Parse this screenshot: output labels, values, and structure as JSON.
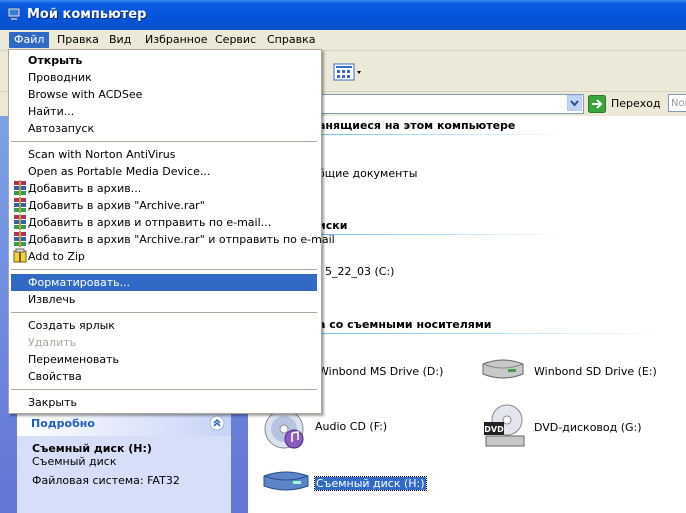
{
  "window": {
    "title": "Мой компьютер"
  },
  "menubar": {
    "items": [
      {
        "label": "Файл",
        "active": true
      },
      {
        "label": "Правка"
      },
      {
        "label": "Вид"
      },
      {
        "label": "Избранное"
      },
      {
        "label": "Сервис"
      },
      {
        "label": "Справка"
      }
    ]
  },
  "address": {
    "go_label": "Переход",
    "next_trunc": "Nor"
  },
  "file_menu": {
    "items": [
      {
        "label": "Открыть",
        "bold": true
      },
      {
        "label": "Проводник"
      },
      {
        "label": "Browse with ACDSee"
      },
      {
        "label": "Найти..."
      },
      {
        "label": "Автозапуск"
      },
      {
        "label": "Scan with Norton AntiVirus"
      },
      {
        "label": "Open as Portable Media Device..."
      },
      {
        "label": "Добавить в архив...",
        "icon": "winrar-icon"
      },
      {
        "label": "Добавить в архив \"Archive.rar\"",
        "icon": "winrar-icon"
      },
      {
        "label": "Добавить в архив и отправить по e-mail...",
        "icon": "winrar-icon"
      },
      {
        "label": "Добавить в архив \"Archive.rar\" и отправить по e-mail",
        "icon": "winrar-icon"
      },
      {
        "label": "Add to Zip",
        "icon": "winzip-icon"
      },
      {
        "label": "Форматировать...",
        "highlighted": true
      },
      {
        "label": "Извлечь"
      },
      {
        "label": "Создать ярлык"
      },
      {
        "label": "Удалить",
        "disabled": true
      },
      {
        "label": "Переименовать"
      },
      {
        "label": "Свойства"
      },
      {
        "label": "Закрыть"
      }
    ]
  },
  "details": {
    "header": "Подробно",
    "name": "Съемный диск (H:)",
    "type": "Съемный диск",
    "filesystem": "Файловая система: FAT32"
  },
  "content": {
    "group_stored_trunc": "анящиеся на этом компьютере",
    "shared_docs_trunc": "бщие документы",
    "group_hdd_trunc": "иски",
    "drive_c_trunc": "5_22_03 (C:)",
    "group_removable_trunc": "а со съемными носителями",
    "drive_d_trunc": "Winbond MS Drive (D:)",
    "drive_e": "Winbond SD Drive (E:)",
    "drive_f": "Audio CD (F:)",
    "drive_g": "DVD-дисковод (G:)",
    "drive_h": "Съемный диск (H:)",
    "dvd_badge": "DVD"
  },
  "colors": {
    "accent": "#316ac5",
    "titlebar": "#0553d8",
    "menubar": "#ece9d8"
  }
}
